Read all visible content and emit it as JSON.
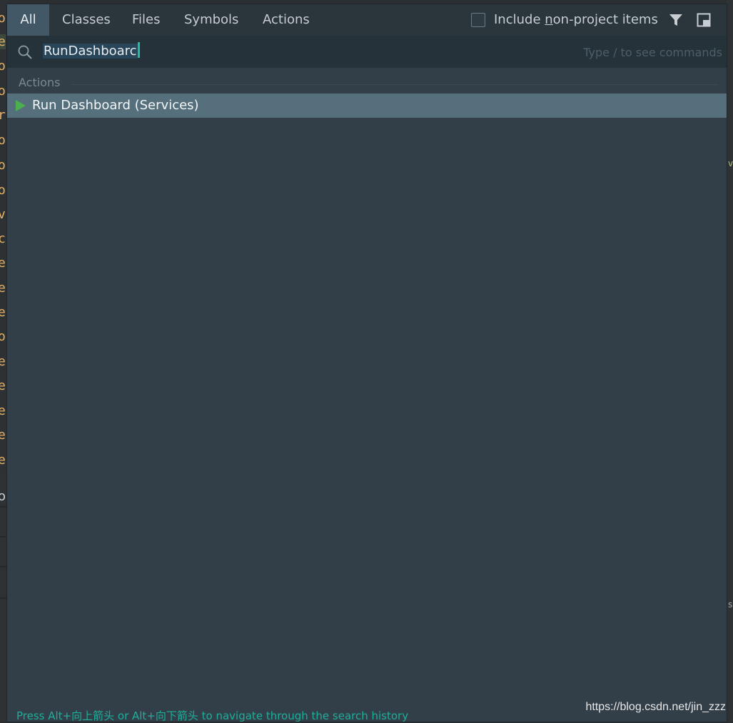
{
  "background_editor": {
    "gutter_chars": [
      "or",
      "e",
      "or",
      "re",
      "or",
      "op",
      "op",
      "op",
      "v",
      "c",
      "e",
      "er",
      "er",
      "or",
      "e",
      "er",
      "er",
      "er",
      "er"
    ],
    "lower_char": "or",
    "right_marks": [
      "v",
      "s"
    ]
  },
  "tabs": [
    {
      "label": "All",
      "active": true
    },
    {
      "label": "Classes",
      "active": false
    },
    {
      "label": "Files",
      "active": false
    },
    {
      "label": "Symbols",
      "active": false
    },
    {
      "label": "Actions",
      "active": false
    }
  ],
  "include_option": {
    "label_prefix": "Include ",
    "label_mnemonic": "n",
    "label_suffix": "on-project items",
    "checked": false
  },
  "toolbar_icons": [
    "filter-icon",
    "preview-panel-icon"
  ],
  "search": {
    "value": "RunDashboarc",
    "hint": "Type / to see commands"
  },
  "results": {
    "section_title": "Actions",
    "items": [
      {
        "label": "Run Dashboard (Services)",
        "icon": "run-icon",
        "selected": true
      }
    ]
  },
  "footer": {
    "hint": "Press Alt+向上箭头 or Alt+向下箭头 to navigate through the search history"
  },
  "watermark": "https://blog.csdn.net/jin_zzz",
  "colors": {
    "popup_bg": "#323f48",
    "tab_active_bg": "#425866",
    "selection_bg": "#556f7c",
    "run_green": "#4caf50",
    "caret": "#1fbfa4"
  }
}
